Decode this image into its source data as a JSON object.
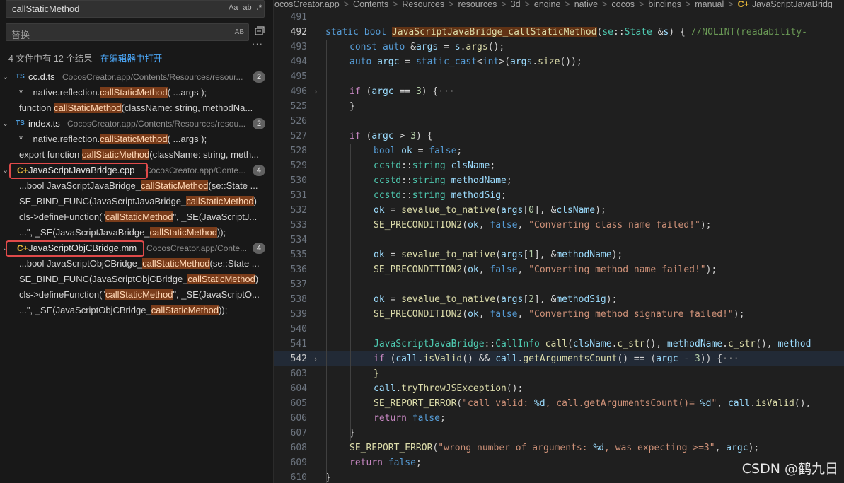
{
  "search": {
    "query": "callStaticMethod",
    "match_case_label": "Aa",
    "whole_word_label": "ab",
    "regex_label": ".*",
    "replace_placeholder": "替换",
    "preserve_case_label": "AB",
    "more_label": "···"
  },
  "summary": {
    "text": "4 文件中有 12 个结果 - ",
    "link": "在编辑器中打开"
  },
  "results": [
    {
      "name": "cc.d.ts",
      "path": "CocosCreator.app/Contents/Resources/resour...",
      "count": "2",
      "icon": "ts-icon",
      "icon_text": "TS",
      "matches": [
        {
          "pre": "*    native.reflection.",
          "hit": "callStaticMethod",
          "post": "( ...args );"
        },
        {
          "pre": "function ",
          "hit": "callStaticMethod",
          "post": "(className: string, methodNa..."
        }
      ]
    },
    {
      "name": "index.ts",
      "path": "CocosCreator.app/Contents/Resources/resou...",
      "count": "2",
      "icon": "ts-icon",
      "icon_text": "TS",
      "matches": [
        {
          "pre": "*    native.reflection.",
          "hit": "callStaticMethod",
          "post": "( ...args );"
        },
        {
          "pre": "export function ",
          "hit": "callStaticMethod",
          "post": "(className: string, meth..."
        }
      ]
    },
    {
      "name": "JavaScriptJavaBridge.cpp",
      "path": "CocosCreator.app/Conte...",
      "count": "4",
      "icon": "cpp-icon",
      "icon_text": "C+",
      "matches": [
        {
          "pre": "...bool JavaScriptJavaBridge_",
          "hit": "callStaticMethod",
          "post": "(se::State ..."
        },
        {
          "pre": "SE_BIND_FUNC(JavaScriptJavaBridge_",
          "hit": "callStaticMethod",
          "post": ")"
        },
        {
          "pre": "cls->defineFunction(\"",
          "hit": "callStaticMethod",
          "post": "\", _SE(JavaScriptJ..."
        },
        {
          "pre": "...\", _SE(JavaScriptJavaBridge_",
          "hit": "callStaticMethod",
          "post": "));"
        }
      ]
    },
    {
      "name": "JavaScriptObjCBridge.mm",
      "path": "CocosCreator.app/Conte...",
      "count": "4",
      "icon": "cpp-icon",
      "icon_text": "C+",
      "matches": [
        {
          "pre": "...bool JavaScriptObjCBridge_",
          "hit": "callStaticMethod",
          "post": "(se::State ..."
        },
        {
          "pre": "SE_BIND_FUNC(JavaScriptObjCBridge_",
          "hit": "callStaticMethod",
          "post": ")"
        },
        {
          "pre": "cls->defineFunction(\"",
          "hit": "callStaticMethod",
          "post": "\", _SE(JavaScriptO..."
        },
        {
          "pre": "...\", _SE(JavaScriptObjCBridge_",
          "hit": "callStaticMethod",
          "post": "));"
        }
      ]
    }
  ],
  "breadcrumb": [
    "ocosCreator.app",
    "Contents",
    "Resources",
    "resources",
    "3d",
    "engine",
    "native",
    "cocos",
    "bindings",
    "manual",
    "JavaScriptJavaBridg"
  ],
  "breadcrumb_sep": ">",
  "watermark": "CSDN @鹤九日",
  "editor": {
    "lines": [
      {
        "n": "491",
        "segs": []
      },
      {
        "n": "492",
        "segs": [
          [
            "k",
            "static "
          ],
          [
            "k",
            "bool "
          ],
          [
            "f fnhl",
            "JavaScriptJavaBridge_callStaticMethod"
          ],
          [
            "p",
            "("
          ],
          [
            "t",
            "se"
          ],
          [
            "p",
            "::"
          ],
          [
            "t",
            "State "
          ],
          [
            "p",
            "&"
          ],
          [
            "v",
            "s"
          ],
          [
            "p",
            ") { "
          ],
          [
            "cm",
            "//NOLINT(readability-"
          ]
        ]
      },
      {
        "n": "493",
        "segs": [
          [
            "k",
            "const "
          ],
          [
            "k",
            "auto "
          ],
          [
            "p",
            "&"
          ],
          [
            "v",
            "args "
          ],
          [
            "p",
            "= "
          ],
          [
            "v",
            "s"
          ],
          [
            "p",
            "."
          ],
          [
            "f",
            "args"
          ],
          [
            "p",
            "();"
          ]
        ]
      },
      {
        "n": "494",
        "segs": [
          [
            "k",
            "auto "
          ],
          [
            "v",
            "argc "
          ],
          [
            "p",
            "= "
          ],
          [
            "k",
            "static_cast"
          ],
          [
            "p",
            "<"
          ],
          [
            "k",
            "int"
          ],
          [
            "p",
            ">("
          ],
          [
            "v",
            "args"
          ],
          [
            "p",
            "."
          ],
          [
            "f",
            "size"
          ],
          [
            "p",
            "());"
          ]
        ]
      },
      {
        "n": "495",
        "segs": []
      },
      {
        "n": "496",
        "fold": true,
        "segs": [
          [
            "c",
            "if "
          ],
          [
            "p",
            "("
          ],
          [
            "v",
            "argc "
          ],
          [
            "p",
            "== "
          ],
          [
            "n",
            "3"
          ],
          [
            "p",
            ") {"
          ],
          [
            "ell",
            "···"
          ]
        ]
      },
      {
        "n": "525",
        "segs": [
          [
            "p",
            "}"
          ]
        ]
      },
      {
        "n": "526",
        "segs": []
      },
      {
        "n": "527",
        "segs": [
          [
            "c",
            "if "
          ],
          [
            "p",
            "("
          ],
          [
            "v",
            "argc "
          ],
          [
            "p",
            "> "
          ],
          [
            "n",
            "3"
          ],
          [
            "p",
            ") {"
          ]
        ]
      },
      {
        "n": "528",
        "segs": [
          [
            "k",
            "bool "
          ],
          [
            "v",
            "ok "
          ],
          [
            "p",
            "= "
          ],
          [
            "k",
            "false"
          ],
          [
            "p",
            ";"
          ]
        ]
      },
      {
        "n": "529",
        "segs": [
          [
            "t",
            "ccstd"
          ],
          [
            "p",
            "::"
          ],
          [
            "t",
            "string "
          ],
          [
            "v",
            "clsName"
          ],
          [
            "p",
            ";"
          ]
        ]
      },
      {
        "n": "530",
        "segs": [
          [
            "t",
            "ccstd"
          ],
          [
            "p",
            "::"
          ],
          [
            "t",
            "string "
          ],
          [
            "v",
            "methodName"
          ],
          [
            "p",
            ";"
          ]
        ]
      },
      {
        "n": "531",
        "segs": [
          [
            "t",
            "ccstd"
          ],
          [
            "p",
            "::"
          ],
          [
            "t",
            "string "
          ],
          [
            "v",
            "methodSig"
          ],
          [
            "p",
            ";"
          ]
        ]
      },
      {
        "n": "532",
        "segs": [
          [
            "v",
            "ok "
          ],
          [
            "p",
            "= "
          ],
          [
            "f",
            "sevalue_to_native"
          ],
          [
            "p",
            "("
          ],
          [
            "v",
            "args"
          ],
          [
            "p",
            "["
          ],
          [
            "n",
            "0"
          ],
          [
            "p",
            "], &"
          ],
          [
            "v",
            "clsName"
          ],
          [
            "p",
            ");"
          ]
        ]
      },
      {
        "n": "533",
        "segs": [
          [
            "f",
            "SE_PRECONDITION2"
          ],
          [
            "p",
            "("
          ],
          [
            "v",
            "ok"
          ],
          [
            "p",
            ", "
          ],
          [
            "k",
            "false"
          ],
          [
            "p",
            ", "
          ],
          [
            "s",
            "\"Converting class name failed!\""
          ],
          [
            "p",
            ");"
          ]
        ]
      },
      {
        "n": "534",
        "segs": []
      },
      {
        "n": "535",
        "segs": [
          [
            "v",
            "ok "
          ],
          [
            "p",
            "= "
          ],
          [
            "f",
            "sevalue_to_native"
          ],
          [
            "p",
            "("
          ],
          [
            "v",
            "args"
          ],
          [
            "p",
            "["
          ],
          [
            "n",
            "1"
          ],
          [
            "p",
            "], &"
          ],
          [
            "v",
            "methodName"
          ],
          [
            "p",
            ");"
          ]
        ]
      },
      {
        "n": "536",
        "segs": [
          [
            "f",
            "SE_PRECONDITION2"
          ],
          [
            "p",
            "("
          ],
          [
            "v",
            "ok"
          ],
          [
            "p",
            ", "
          ],
          [
            "k",
            "false"
          ],
          [
            "p",
            ", "
          ],
          [
            "s",
            "\"Converting method name failed!\""
          ],
          [
            "p",
            ");"
          ]
        ]
      },
      {
        "n": "537",
        "segs": []
      },
      {
        "n": "538",
        "segs": [
          [
            "v",
            "ok "
          ],
          [
            "p",
            "= "
          ],
          [
            "f",
            "sevalue_to_native"
          ],
          [
            "p",
            "("
          ],
          [
            "v",
            "args"
          ],
          [
            "p",
            "["
          ],
          [
            "n",
            "2"
          ],
          [
            "p",
            "], &"
          ],
          [
            "v",
            "methodSig"
          ],
          [
            "p",
            ");"
          ]
        ]
      },
      {
        "n": "539",
        "segs": [
          [
            "f",
            "SE_PRECONDITION2"
          ],
          [
            "p",
            "("
          ],
          [
            "v",
            "ok"
          ],
          [
            "p",
            ", "
          ],
          [
            "k",
            "false"
          ],
          [
            "p",
            ", "
          ],
          [
            "s",
            "\"Converting method signature failed!\""
          ],
          [
            "p",
            ");"
          ]
        ]
      },
      {
        "n": "540",
        "segs": []
      },
      {
        "n": "541",
        "segs": [
          [
            "t",
            "JavaScriptJavaBridge"
          ],
          [
            "p",
            "::"
          ],
          [
            "t",
            "CallInfo "
          ],
          [
            "f",
            "call"
          ],
          [
            "p",
            "("
          ],
          [
            "v",
            "clsName"
          ],
          [
            "p",
            "."
          ],
          [
            "f",
            "c_str"
          ],
          [
            "p",
            "(), "
          ],
          [
            "v",
            "methodName"
          ],
          [
            "p",
            "."
          ],
          [
            "f",
            "c_str"
          ],
          [
            "p",
            "(), "
          ],
          [
            "v",
            "method"
          ]
        ]
      },
      {
        "n": "542",
        "fold": true,
        "current": true,
        "segs": [
          [
            "c",
            "if "
          ],
          [
            "p",
            "("
          ],
          [
            "v",
            "call"
          ],
          [
            "p",
            "."
          ],
          [
            "f",
            "isValid"
          ],
          [
            "p",
            "() && "
          ],
          [
            "v",
            "call"
          ],
          [
            "p",
            "."
          ],
          [
            "f",
            "getArgumentsCount"
          ],
          [
            "p",
            "() == ("
          ],
          [
            "v",
            "argc "
          ],
          [
            "p",
            "- "
          ],
          [
            "n",
            "3"
          ],
          [
            "p",
            ")) {"
          ],
          [
            "ell",
            "···"
          ]
        ]
      },
      {
        "n": "603",
        "segs": [
          [
            "f",
            "}"
          ]
        ]
      },
      {
        "n": "604",
        "segs": [
          [
            "v",
            "call"
          ],
          [
            "p",
            "."
          ],
          [
            "f",
            "tryThrowJSException"
          ],
          [
            "p",
            "();"
          ]
        ]
      },
      {
        "n": "605",
        "segs": [
          [
            "f",
            "SE_REPORT_ERROR"
          ],
          [
            "p",
            "("
          ],
          [
            "s",
            "\"call valid: "
          ],
          [
            "fmt",
            "%d"
          ],
          [
            "s",
            ", call.getArgumentsCount()= "
          ],
          [
            "fmt",
            "%d"
          ],
          [
            "s",
            "\""
          ],
          [
            "p",
            ", "
          ],
          [
            "v",
            "call"
          ],
          [
            "p",
            "."
          ],
          [
            "f",
            "isValid"
          ],
          [
            "p",
            "(),"
          ]
        ]
      },
      {
        "n": "606",
        "segs": [
          [
            "c",
            "return "
          ],
          [
            "k",
            "false"
          ],
          [
            "p",
            ";"
          ]
        ]
      },
      {
        "n": "607",
        "segs": [
          [
            "p",
            "}"
          ]
        ]
      },
      {
        "n": "608",
        "segs": [
          [
            "f",
            "SE_REPORT_ERROR"
          ],
          [
            "p",
            "("
          ],
          [
            "s",
            "\"wrong number of arguments: "
          ],
          [
            "fmt",
            "%d"
          ],
          [
            "s",
            ", was expecting >=3\""
          ],
          [
            "p",
            ", "
          ],
          [
            "v",
            "argc"
          ],
          [
            "p",
            ");"
          ]
        ]
      },
      {
        "n": "609",
        "segs": [
          [
            "c",
            "return "
          ],
          [
            "k",
            "false"
          ],
          [
            "p",
            ";"
          ]
        ]
      },
      {
        "n": "610",
        "segs": [
          [
            "p",
            "}"
          ]
        ]
      }
    ]
  }
}
